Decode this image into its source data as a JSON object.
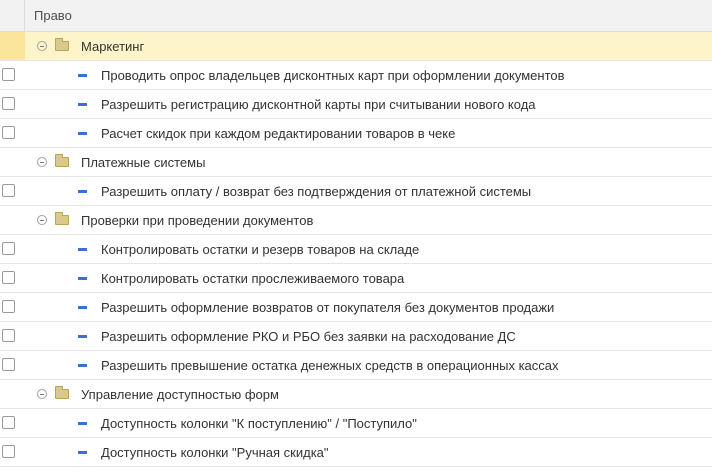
{
  "header": {
    "column_title": "Право"
  },
  "tree": [
    {
      "type": "group",
      "label": "Маркетинг",
      "selected": true,
      "items": [
        "Проводить опрос владельцев дисконтных карт при оформлении документов",
        "Разрешить регистрацию дисконтной карты при считывании нового кода",
        "Расчет скидок при каждом редактировании товаров в чеке"
      ]
    },
    {
      "type": "group",
      "label": "Платежные системы",
      "selected": false,
      "items": [
        "Разрешить оплату / возврат без подтверждения от платежной системы"
      ]
    },
    {
      "type": "group",
      "label": "Проверки при проведении документов",
      "selected": false,
      "items": [
        "Контролировать остатки и резерв товаров на складе",
        "Контролировать остатки прослеживаемого товара",
        "Разрешить оформление возвратов от покупателя без документов продажи",
        "Разрешить оформление РКО и РБО без заявки на расходование ДС",
        "Разрешить превышение остатка денежных средств в операционных кассах"
      ]
    },
    {
      "type": "group",
      "label": "Управление доступностью форм",
      "selected": false,
      "items": [
        "Доступность колонки \"К поступлению\" / \"Поступило\"",
        "Доступность колонки \"Ручная скидка\""
      ]
    }
  ],
  "icons": {
    "expander": "collapse-circle-icon",
    "group": "folder-icon",
    "item": "permission-dash-icon"
  },
  "colors": {
    "selected_row": "#fdf5c9",
    "item_icon": "#3a6fd6",
    "folder": "#d9c98a"
  }
}
